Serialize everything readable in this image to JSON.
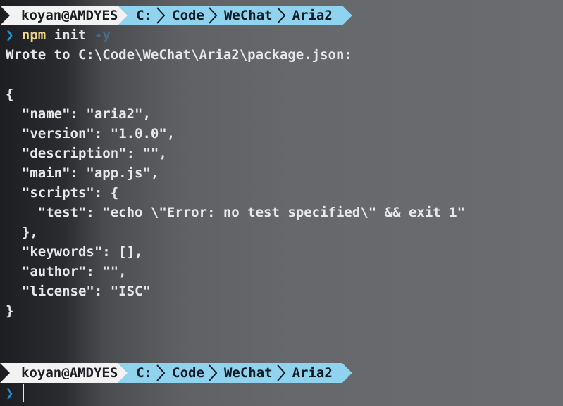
{
  "prompt1": {
    "user": "koyan@AMDYES",
    "path": [
      "C:",
      "Code",
      "WeChat",
      "Aria2"
    ]
  },
  "command": {
    "symbol": "❯",
    "program": "npm",
    "args": "init",
    "flag": "-y"
  },
  "output": [
    "Wrote to C:\\Code\\WeChat\\Aria2\\package.json:",
    "",
    "{",
    "  \"name\": \"aria2\",",
    "  \"version\": \"1.0.0\",",
    "  \"description\": \"\",",
    "  \"main\": \"app.js\",",
    "  \"scripts\": {",
    "    \"test\": \"echo \\\"Error: no test specified\\\" && exit 1\"",
    "  },",
    "  \"keywords\": [],",
    "  \"author\": \"\",",
    "  \"license\": \"ISC\"",
    "}"
  ],
  "prompt2": {
    "user": "koyan@AMDYES",
    "path": [
      "C:",
      "Code",
      "WeChat",
      "Aria2"
    ],
    "symbol": "❯"
  },
  "colors": {
    "user_segment": "#f2f2f2",
    "path_segment": "#8fd3ee",
    "prompt_symbol": "#1e8fd6",
    "npm": "#f0d58a"
  }
}
